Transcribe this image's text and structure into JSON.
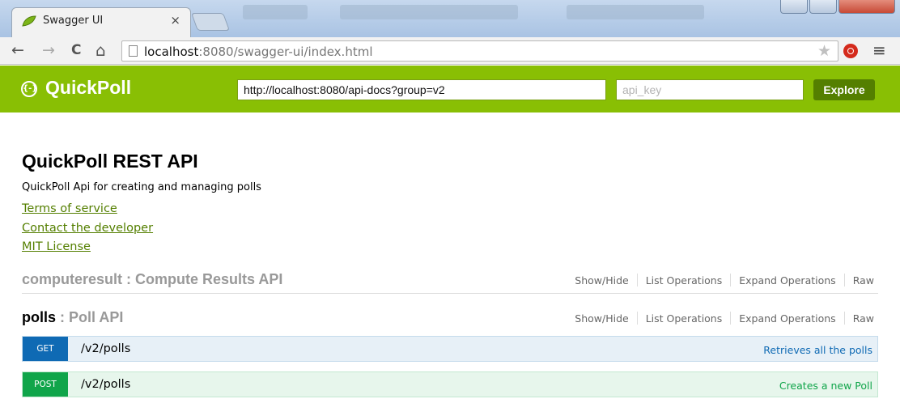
{
  "browser": {
    "tab_title": "Swagger UI",
    "tab_close": "×",
    "url_host": "localhost",
    "url_rest": ":8080/swagger-ui/index.html",
    "nav_icons": [
      "back-arrow-icon",
      "forward-arrow-icon",
      "reload-icon",
      "home-icon"
    ],
    "nav_glyphs": {
      "back": "←",
      "forward": "→",
      "reload": "C",
      "home": "⌂"
    },
    "star": "★",
    "menu": "≡"
  },
  "header": {
    "logo_glyph": "{-}",
    "title": "QuickPoll",
    "discovery_url": "http://localhost:8080/api-docs?group=v2",
    "api_key_placeholder": "api_key",
    "explore_label": "Explore",
    "accent_color": "#89bf04"
  },
  "info": {
    "title": "QuickPoll REST API",
    "description": "QuickPoll Api for creating and managing polls",
    "links": [
      "Terms of service",
      "Contact the developer",
      "MIT License"
    ]
  },
  "resources": [
    {
      "name": "computeresult",
      "separator": " : ",
      "description": "Compute Results API",
      "actions": [
        "Show/Hide",
        "List Operations",
        "Expand Operations",
        "Raw"
      ]
    },
    {
      "name": "polls",
      "separator": " : ",
      "description": "Poll API",
      "actions": [
        "Show/Hide",
        "List Operations",
        "Expand Operations",
        "Raw"
      ]
    }
  ],
  "operations": [
    {
      "method": "GET",
      "path": "/v2/polls",
      "summary": "Retrieves all the polls",
      "color": "#0f6ab4"
    },
    {
      "method": "POST",
      "path": "/v2/polls",
      "summary": "Creates a new Poll",
      "color": "#10a54a"
    }
  ]
}
